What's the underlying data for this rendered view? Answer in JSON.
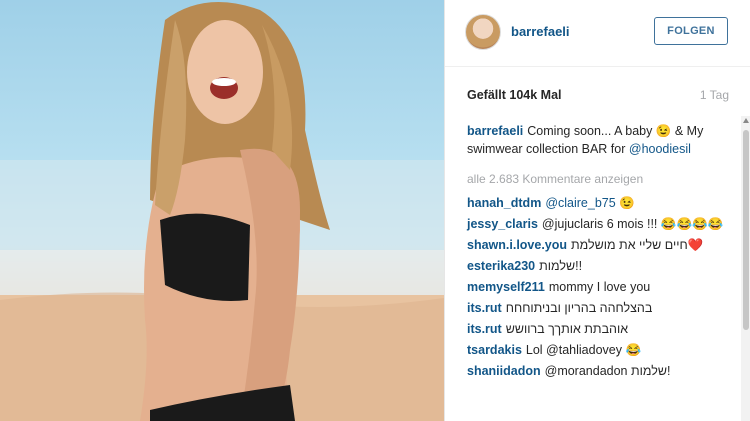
{
  "post": {
    "username": "barrefaeli",
    "follow_label": "FOLGEN",
    "likes": "Gefällt 104k Mal",
    "time": "1 Tag",
    "caption_user": "barrefaeli",
    "caption_text": "Coming soon... A baby 😉 & My swimwear collection BAR for",
    "caption_mention": "@hoodiesil",
    "view_all": "alle 2.683 Kommentare anzeigen"
  },
  "comments": [
    {
      "user": "hanah_dtdm",
      "text": "@claire_b75 😉"
    },
    {
      "user": "jessy_claris",
      "text": "@jujuclaris 6 mois !!! 😂😂😂😂"
    },
    {
      "user": "shawn.i.love.you",
      "text": "חיים שליי את מושלמת❤️"
    },
    {
      "user": "esterika230",
      "text": "שלמות!!"
    },
    {
      "user": "memyself211",
      "text": "mommy I love you"
    },
    {
      "user": "its.rut",
      "text": "בהצלחהה בהריון ובניתוחחח"
    },
    {
      "user": "its.rut",
      "text": "אוהבתת אותךך ברוושש"
    },
    {
      "user": "tsardakis",
      "text": "Lol @tahliadovey 😂"
    },
    {
      "user": "shaniidadon",
      "text": "@morandadon שלמות!"
    }
  ],
  "icons": {
    "avatar": "profile-avatar",
    "scroll": "scrollbar"
  }
}
